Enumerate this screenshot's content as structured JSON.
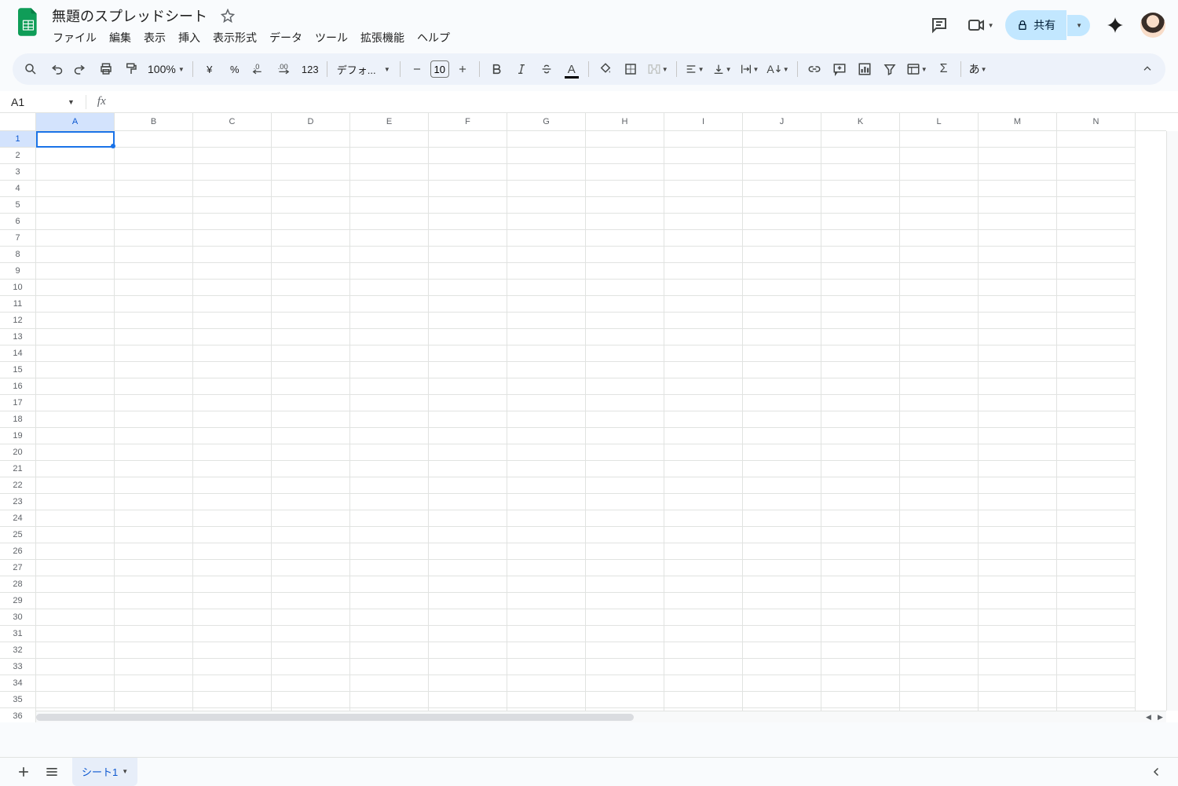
{
  "doc_title": "無題のスプレッドシート",
  "menus": [
    "ファイル",
    "編集",
    "表示",
    "挿入",
    "表示形式",
    "データ",
    "ツール",
    "拡張機能",
    "ヘルプ"
  ],
  "share_label": "共有",
  "toolbar": {
    "zoom": "100%",
    "currency": "¥",
    "percent": "%",
    "num_format": "123",
    "font_name": "デフォ...",
    "font_size": "10",
    "input_method": "あ"
  },
  "namebox": "A1",
  "formula": "",
  "columns": [
    "A",
    "B",
    "C",
    "D",
    "E",
    "F",
    "G",
    "H",
    "I",
    "J",
    "K",
    "L",
    "M",
    "N"
  ],
  "row_count": 37,
  "selected_col": 0,
  "selected_row": 0,
  "sheet_tab": "シート1"
}
